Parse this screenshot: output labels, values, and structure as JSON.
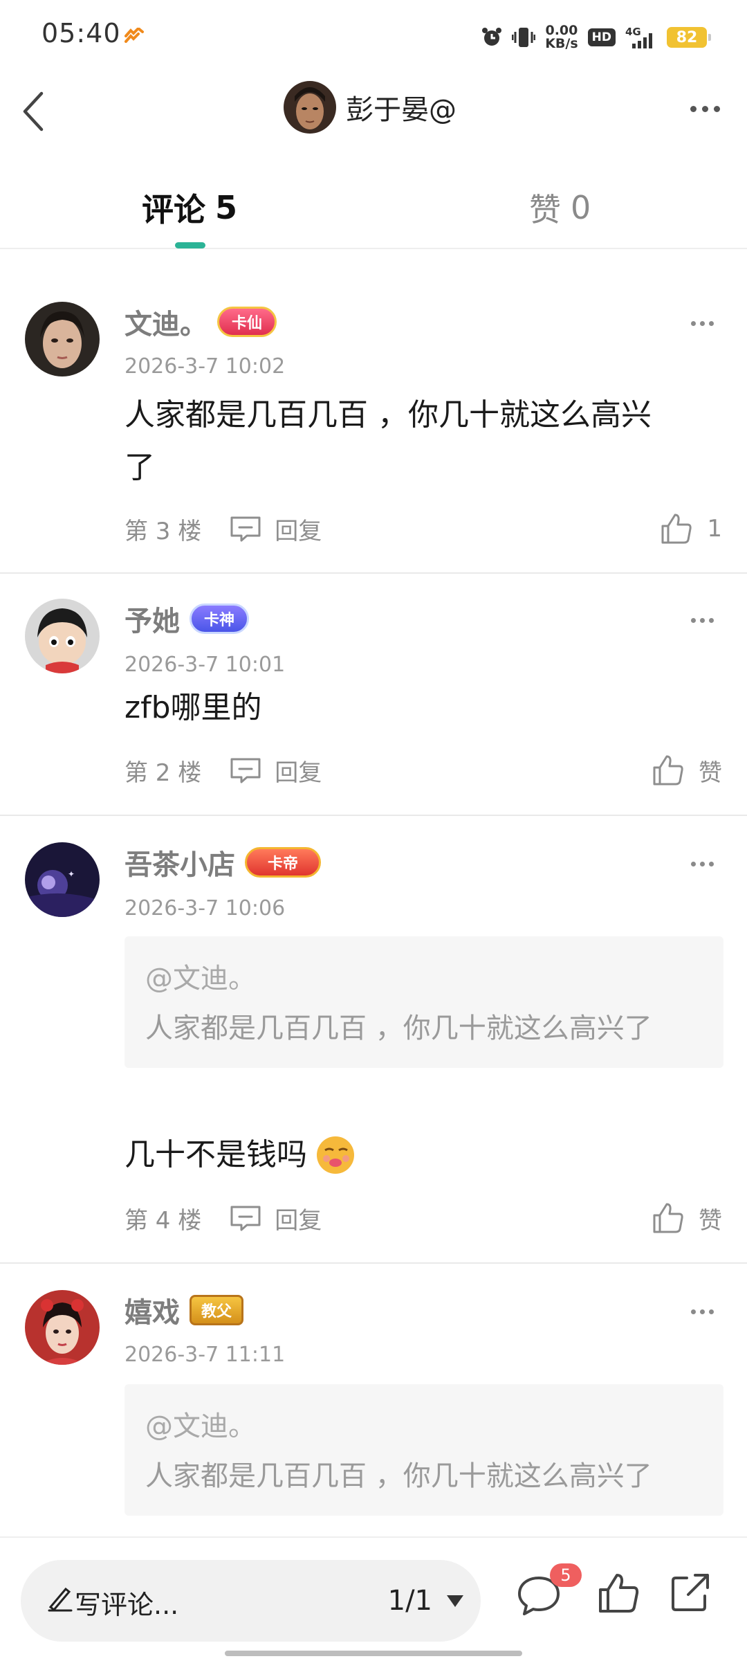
{
  "status_bar": {
    "time": "05:40",
    "net_speed_value": "0.00",
    "net_speed_unit": "KB/s",
    "hd_label": "HD",
    "network": "4G",
    "battery": "82"
  },
  "header": {
    "title": "彭于晏@"
  },
  "tabs": [
    {
      "label": "评论",
      "count": "5",
      "active": true
    },
    {
      "label": "赞",
      "count": "0",
      "active": false
    }
  ],
  "comments": [
    {
      "name": "文迪。",
      "badge": "卡仙",
      "time": "2026-3-7 10:02",
      "text_line1": "人家都是几百几百 ，你几十就这么高兴",
      "text_line2": "了",
      "floor": "第 3 楼",
      "reply_label": "回复",
      "like_label": "1"
    },
    {
      "name": "予她",
      "badge": "卡神",
      "time": "2026-3-7 10:01",
      "text_line1": "zfb哪里的",
      "floor": "第 2 楼",
      "reply_label": "回复",
      "like_label": "赞"
    },
    {
      "name": "吾茶小店",
      "badge": "卡帝",
      "time": "2026-3-7 10:06",
      "quote_at": "@文迪。",
      "quote_text": "人家都是几百几百 ，你几十就这么高兴了",
      "text_line1": "几十不是钱吗",
      "floor": "第 4 楼",
      "reply_label": "回复",
      "like_label": "赞"
    },
    {
      "name": "嬉戏",
      "badge": "教父",
      "time": "2026-3-7 11:11",
      "quote_at": "@文迪。",
      "quote_text": "人家都是几百几百 ，你几十就这么高兴了"
    }
  ],
  "bottom_bar": {
    "input_placeholder": "写评论...",
    "page_indicator": "1/1",
    "comment_count": "5"
  },
  "colors": {
    "accent": "#2bb396",
    "badge_red": "#ef5f5f",
    "battery": "#f1c232"
  }
}
